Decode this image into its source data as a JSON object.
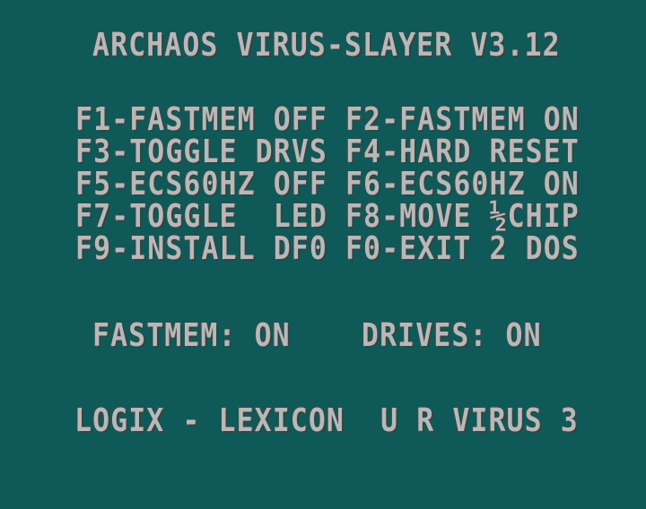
{
  "title": "ARCHAOS VIRUS-SLAYER V3.12",
  "menu": {
    "rows": [
      {
        "left": "F1-FASTMEM OFF",
        "right": "F2-FASTMEM ON"
      },
      {
        "left": "F3-TOGGLE DRVS",
        "right": "F4-HARD RESET"
      },
      {
        "left": "F5-ECS60HZ OFF",
        "right": "F6-ECS60HZ ON"
      },
      {
        "left": "F7-TOGGLE  LED",
        "right": "F8-MOVE ½CHIP"
      },
      {
        "left": "F9-INSTALL DF0",
        "right": "F0-EXIT 2 DOS"
      }
    ]
  },
  "status": {
    "fastmem": "FASTMEM: ON",
    "drives": "DRIVES: ON"
  },
  "footer": "LOGIX - LEXICON  U R VIRUS 3",
  "colors": {
    "background": "#0f5a58",
    "text": "#b8b8b8",
    "shadow": "#3f3f3f"
  }
}
